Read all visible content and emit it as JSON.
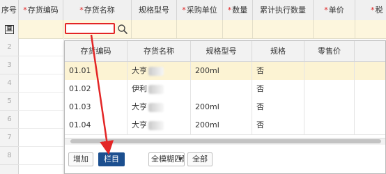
{
  "grid": {
    "columns": [
      {
        "label": "序号",
        "required": false
      },
      {
        "label": "存货编码",
        "required": true
      },
      {
        "label": "存货名称",
        "required": true
      },
      {
        "label": "规格型号",
        "required": false
      },
      {
        "label": "采购单位",
        "required": true
      },
      {
        "label": "数量",
        "required": true
      },
      {
        "label": "累计执行数量",
        "required": false
      },
      {
        "label": "单价",
        "required": true
      },
      {
        "label": "税",
        "required": true
      }
    ],
    "required_mark": "*",
    "insert_icon": "insert-row-icon",
    "insert_glyph": "亘",
    "row_numbers": [
      "2",
      "3",
      "4",
      "5",
      "6",
      "7",
      "8"
    ]
  },
  "lookup": {
    "columns": [
      "存货编码",
      "存货名称",
      "规格型号",
      "规格",
      "零售价"
    ],
    "rows": [
      {
        "code": "01.01",
        "name": "大亨",
        "spec_model": "200ml",
        "spec": "否",
        "price": "",
        "selected": true
      },
      {
        "code": "01.02",
        "name": "伊利",
        "spec_model": "",
        "spec": "否",
        "price": "",
        "selected": false
      },
      {
        "code": "01.03",
        "name": "大亨",
        "spec_model": "200ml",
        "spec": "否",
        "price": "",
        "selected": false
      },
      {
        "code": "01.04",
        "name": "大亨",
        "spec_model": "200ml",
        "spec": "否",
        "price": "",
        "selected": false
      }
    ],
    "toolbar": {
      "add_label": "增加",
      "columns_label": "栏目",
      "match_mode": "全模糊匹配",
      "all_label": "全部"
    }
  },
  "colors": {
    "header_bg": "#f0f0f0",
    "selected_row_bg": "#fdf6dd",
    "required_mark": "#e02020",
    "primary_button": "#1c4f8f",
    "annotation_red": "#e32525"
  },
  "icons": [
    "search-icon",
    "insert-row-icon",
    "chevron-down-icon"
  ]
}
